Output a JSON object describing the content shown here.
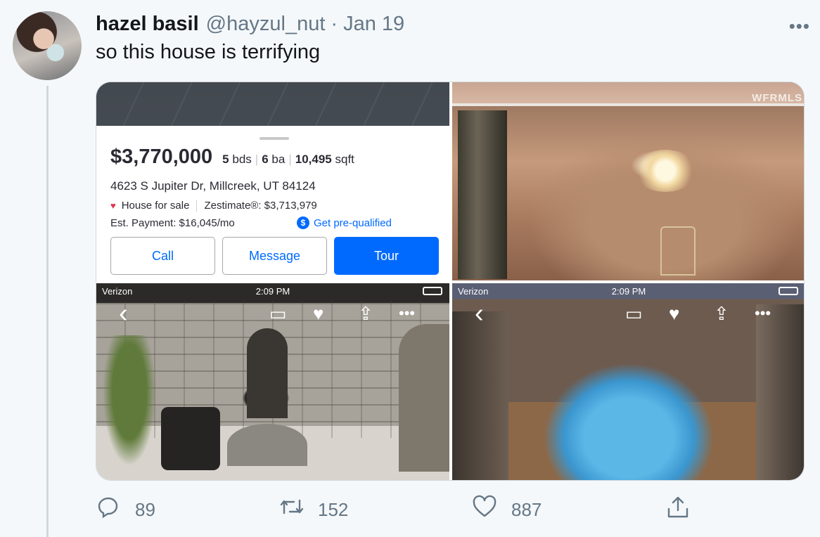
{
  "tweet": {
    "display_name": "hazel basil",
    "handle": "@hayzul_nut",
    "separator": "·",
    "date": "Jan 19",
    "text": "so this house is terrifying",
    "more_icon": "more-icon"
  },
  "listing": {
    "price": "$3,770,000",
    "beds": "5",
    "beds_unit": "bds",
    "baths": "6",
    "baths_unit": "ba",
    "sqft": "10,495",
    "sqft_unit": "sqft",
    "address": "4623 S Jupiter Dr, Millcreek, UT 84124",
    "status": "House for sale",
    "zestimate": "Zestimate®: $3,713,979",
    "payment": "Est. Payment: $16,045/mo",
    "prequal": "Get pre-qualified",
    "buttons": {
      "call": "Call",
      "message": "Message",
      "tour": "Tour"
    }
  },
  "photos": {
    "watermark": "WFRMLS",
    "status_bar": {
      "carrier": "Verizon",
      "time": "2:09 PM"
    }
  },
  "actions": {
    "replies": "89",
    "retweets": "152",
    "likes": "887"
  },
  "colors": {
    "zillow_blue": "#006aff",
    "twitter_gray": "#657786",
    "heart_red": "#e0344b"
  }
}
